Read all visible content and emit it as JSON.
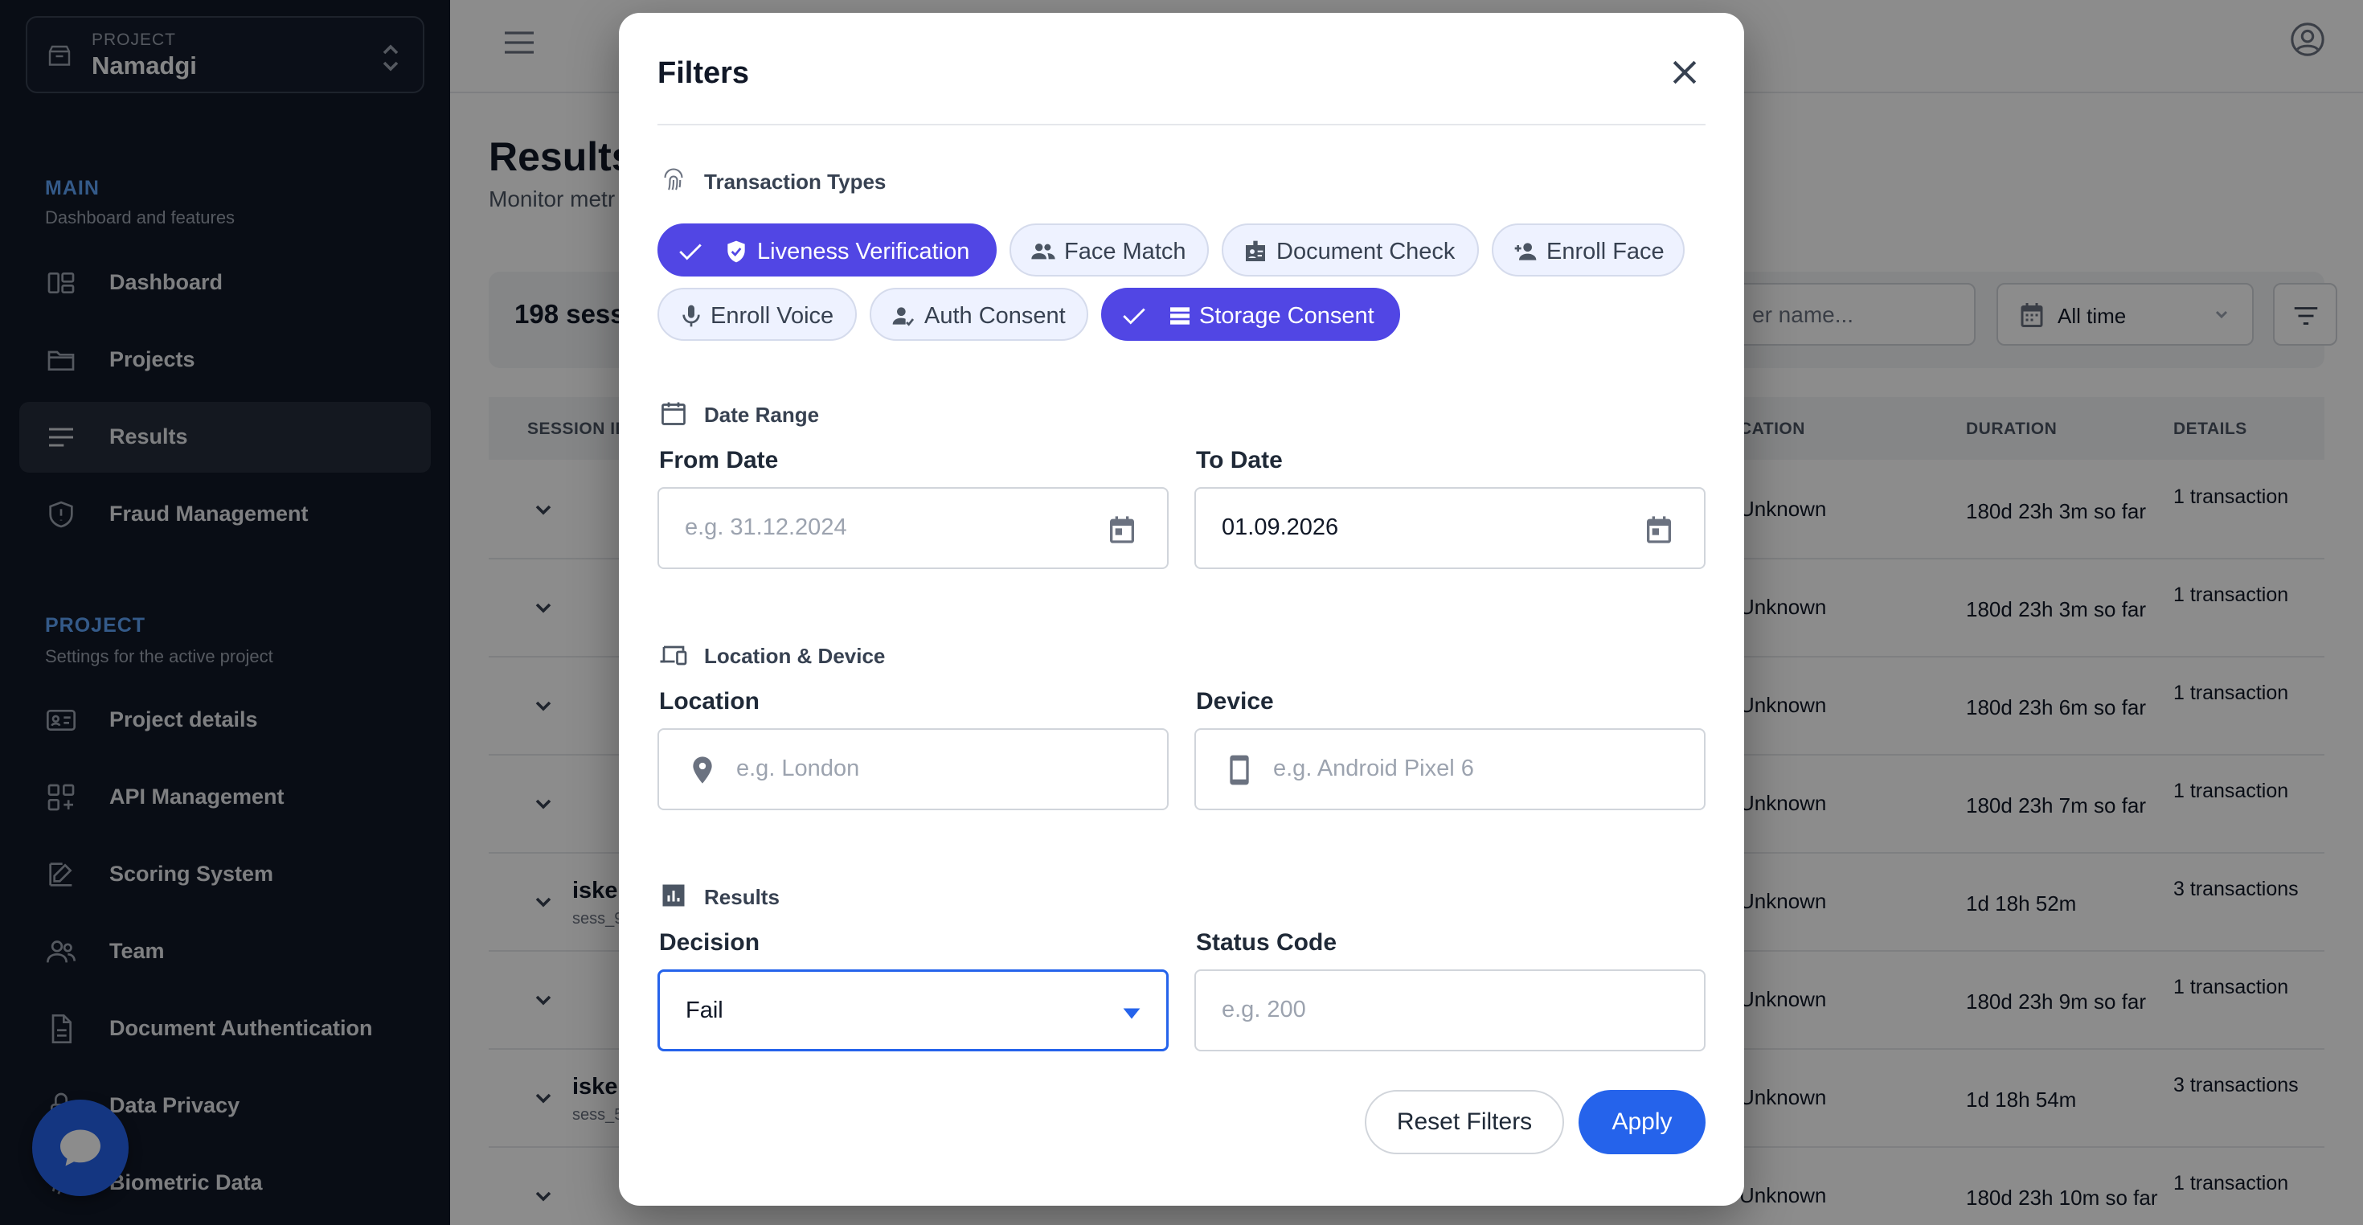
{
  "sidebar": {
    "project_caption": "PROJECT",
    "project_name": "Namadgi",
    "main_section": {
      "title": "MAIN",
      "subtitle": "Dashboard and features"
    },
    "main_items": [
      {
        "label": "Dashboard",
        "icon": "dashboard-icon"
      },
      {
        "label": "Projects",
        "icon": "folder-icon"
      },
      {
        "label": "Results",
        "icon": "list-icon",
        "active": true
      },
      {
        "label": "Fraud Management",
        "icon": "shield-icon"
      }
    ],
    "project_section": {
      "title": "PROJECT",
      "subtitle": "Settings for the active project"
    },
    "project_items": [
      {
        "label": "Project details",
        "icon": "id-card-icon"
      },
      {
        "label": "API Management",
        "icon": "grid-plus-icon"
      },
      {
        "label": "Scoring System",
        "icon": "edit-icon"
      },
      {
        "label": "Team",
        "icon": "users-icon"
      },
      {
        "label": "Document Authentication",
        "icon": "document-icon"
      },
      {
        "label": "Data Privacy",
        "icon": "lock-icon"
      },
      {
        "label": "Biometric Data",
        "icon": "fingerprint-icon"
      }
    ]
  },
  "page": {
    "title": "Results",
    "subtitle": "Monitor metr",
    "session_count": "198 sess",
    "search_placeholder": "er name...",
    "time_filter": "All time",
    "table_headers": {
      "session": "SESSION ID",
      "location": "CATION",
      "duration": "DURATION",
      "details": "DETAILS"
    },
    "rows": [
      {
        "name": "",
        "sid": "",
        "location": "Unknown",
        "duration": "180d 23h 3m so far",
        "details": "1 transaction"
      },
      {
        "name": "",
        "sid": "",
        "location": "Unknown",
        "duration": "180d 23h 3m so far",
        "details": "1 transaction"
      },
      {
        "name": "",
        "sid": "",
        "location": "Unknown",
        "duration": "180d 23h 6m so far",
        "details": "1 transaction"
      },
      {
        "name": "",
        "sid": "",
        "location": "Unknown",
        "duration": "180d 23h 7m so far",
        "details": "1 transaction"
      },
      {
        "name": "isker",
        "sid": "sess_9",
        "location": "Unknown",
        "duration": "1d 18h 52m",
        "details": "3 transactions"
      },
      {
        "name": "",
        "sid": "",
        "location": "Unknown",
        "duration": "180d 23h 9m so far",
        "details": "1 transaction"
      },
      {
        "name": "isker",
        "sid": "sess_5",
        "location": "Unknown",
        "duration": "1d 18h 54m",
        "details": "3 transactions"
      },
      {
        "name": "",
        "sid": "",
        "location": "Unknown",
        "duration": "180d 23h 10m so far",
        "details": "1 transaction"
      }
    ]
  },
  "filters": {
    "title": "Filters",
    "transaction_types": {
      "heading": "Transaction Types",
      "chips": [
        {
          "label": "Liveness Verification",
          "icon": "shield-check-icon",
          "selected": true
        },
        {
          "label": "Face Match",
          "icon": "people-icon",
          "selected": false
        },
        {
          "label": "Document Check",
          "icon": "badge-icon",
          "selected": false
        },
        {
          "label": "Enroll Face",
          "icon": "person-add-icon",
          "selected": false
        },
        {
          "label": "Enroll Voice",
          "icon": "microphone-icon",
          "selected": false
        },
        {
          "label": "Auth Consent",
          "icon": "person-check-icon",
          "selected": false
        },
        {
          "label": "Storage Consent",
          "icon": "storage-icon",
          "selected": true
        }
      ]
    },
    "date_range": {
      "heading": "Date Range",
      "from_label": "From Date",
      "from_placeholder": "e.g. 31.12.2024",
      "from_value": "",
      "to_label": "To Date",
      "to_value": "01.09.2026"
    },
    "location_device": {
      "heading": "Location & Device",
      "location_label": "Location",
      "location_placeholder": "e.g. London",
      "device_label": "Device",
      "device_placeholder": "e.g. Android Pixel 6"
    },
    "results": {
      "heading": "Results",
      "decision_label": "Decision",
      "decision_value": "Fail",
      "status_label": "Status Code",
      "status_placeholder": "e.g. 200"
    },
    "reset_label": "Reset Filters",
    "apply_label": "Apply"
  },
  "colors": {
    "sidebar_bg": "#111827",
    "accent": "#2563eb",
    "chip_selected": "#5146e4",
    "section_title": "#60a5fa"
  }
}
